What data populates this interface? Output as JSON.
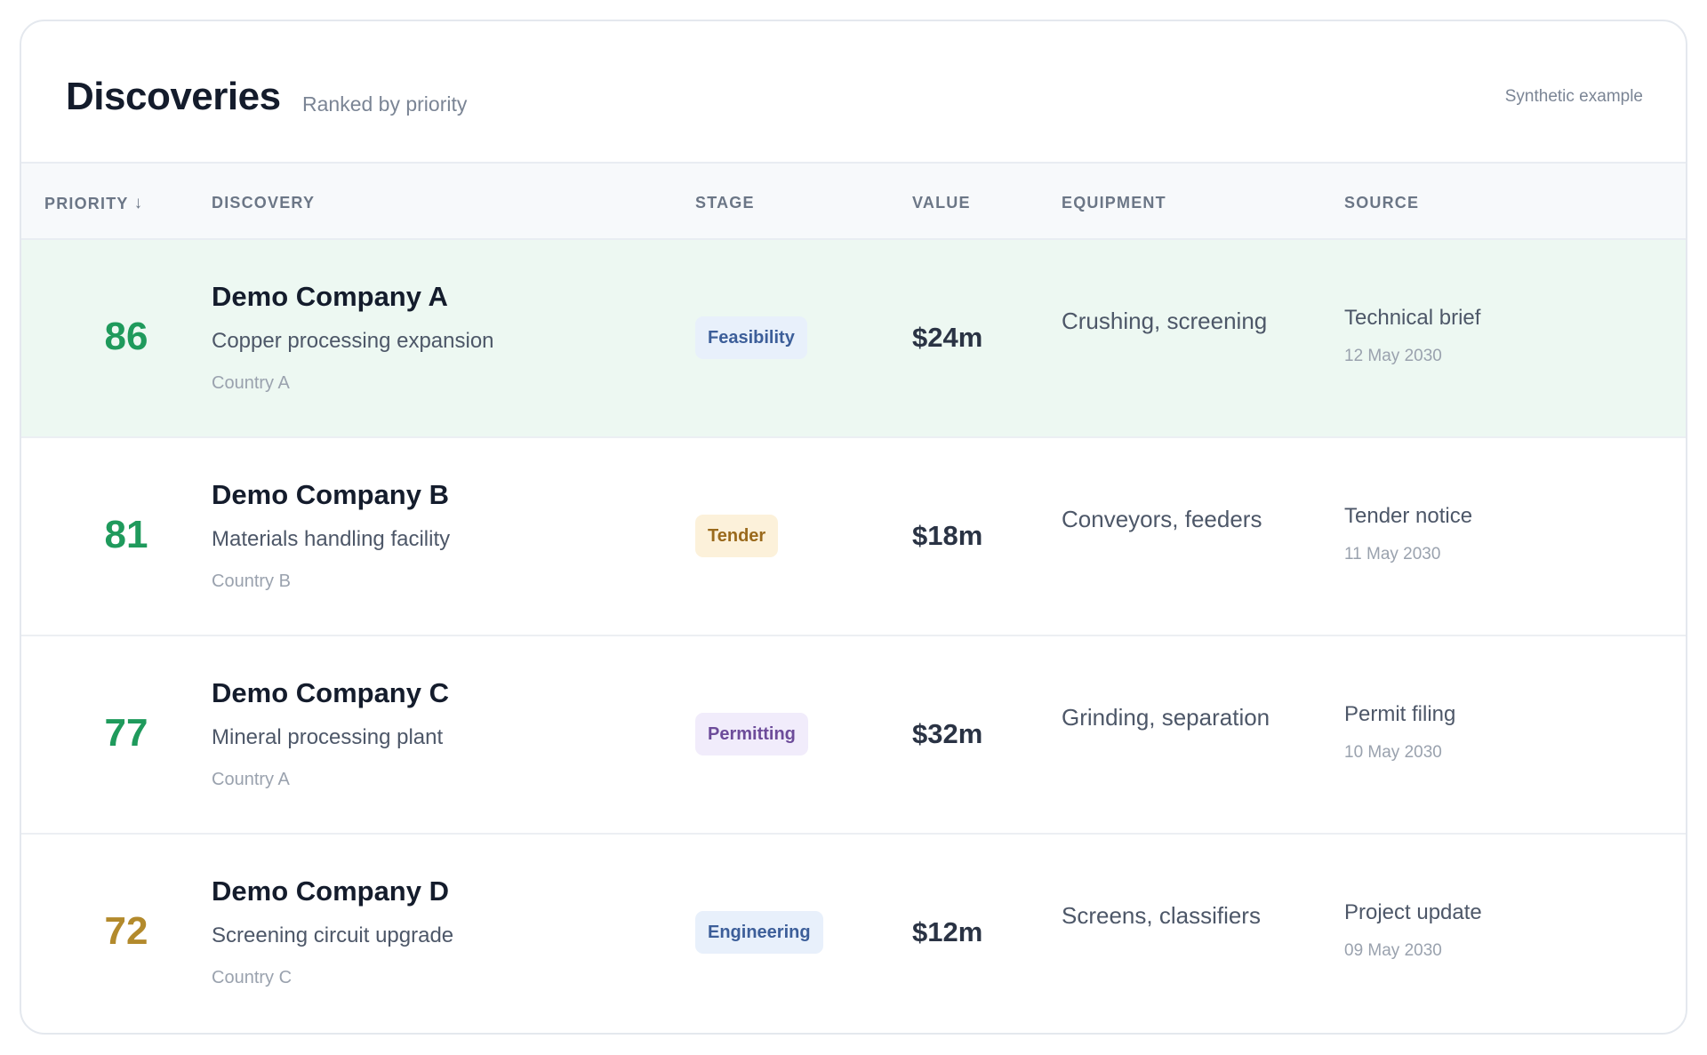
{
  "header": {
    "title": "Discoveries",
    "subtitle": "Ranked by priority",
    "tag": "Synthetic example"
  },
  "columns": {
    "priority": "PRIORITY",
    "discovery": "DISCOVERY",
    "stage": "STAGE",
    "value": "VALUE",
    "equipment": "EQUIPMENT",
    "source": "SOURCE",
    "sort_icon": "arrow-down-icon"
  },
  "colors": {
    "priority_high": "#1f9a5c",
    "priority_mid": "#b38a2c",
    "highlight_row": "#edf8f2"
  },
  "rows": [
    {
      "score": "86",
      "score_color": "#1f9a5c",
      "company": "Demo Company A",
      "project": "Copper processing expansion",
      "country": "Country A",
      "stage": "Feasibility",
      "stage_bg": "#e8f0fb",
      "stage_fg": "#3c5e99",
      "value": "$24m",
      "equipment": "Crushing, screening",
      "source": "Technical brief",
      "date": "12 May 2030",
      "highlighted": true
    },
    {
      "score": "81",
      "score_color": "#1f9a5c",
      "company": "Demo Company B",
      "project": "Materials handling facility",
      "country": "Country B",
      "stage": "Tender",
      "stage_bg": "#fcf1da",
      "stage_fg": "#9a6a1c",
      "value": "$18m",
      "equipment": "Conveyors, feeders",
      "source": "Tender notice",
      "date": "11 May 2030",
      "highlighted": false
    },
    {
      "score": "77",
      "score_color": "#1f9a5c",
      "company": "Demo Company C",
      "project": "Mineral processing plant",
      "country": "Country A",
      "stage": "Permitting",
      "stage_bg": "#f1ecfb",
      "stage_fg": "#6d4c9a",
      "value": "$32m",
      "equipment": "Grinding, separation",
      "source": "Permit filing",
      "date": "10 May 2030",
      "highlighted": false
    },
    {
      "score": "72",
      "score_color": "#b38a2c",
      "company": "Demo Company D",
      "project": "Screening circuit upgrade",
      "country": "Country C",
      "stage": "Engineering",
      "stage_bg": "#e8f0fb",
      "stage_fg": "#3c5e99",
      "value": "$12m",
      "equipment": "Screens, classifiers",
      "source": "Project update",
      "date": "09 May 2030",
      "highlighted": false
    }
  ]
}
